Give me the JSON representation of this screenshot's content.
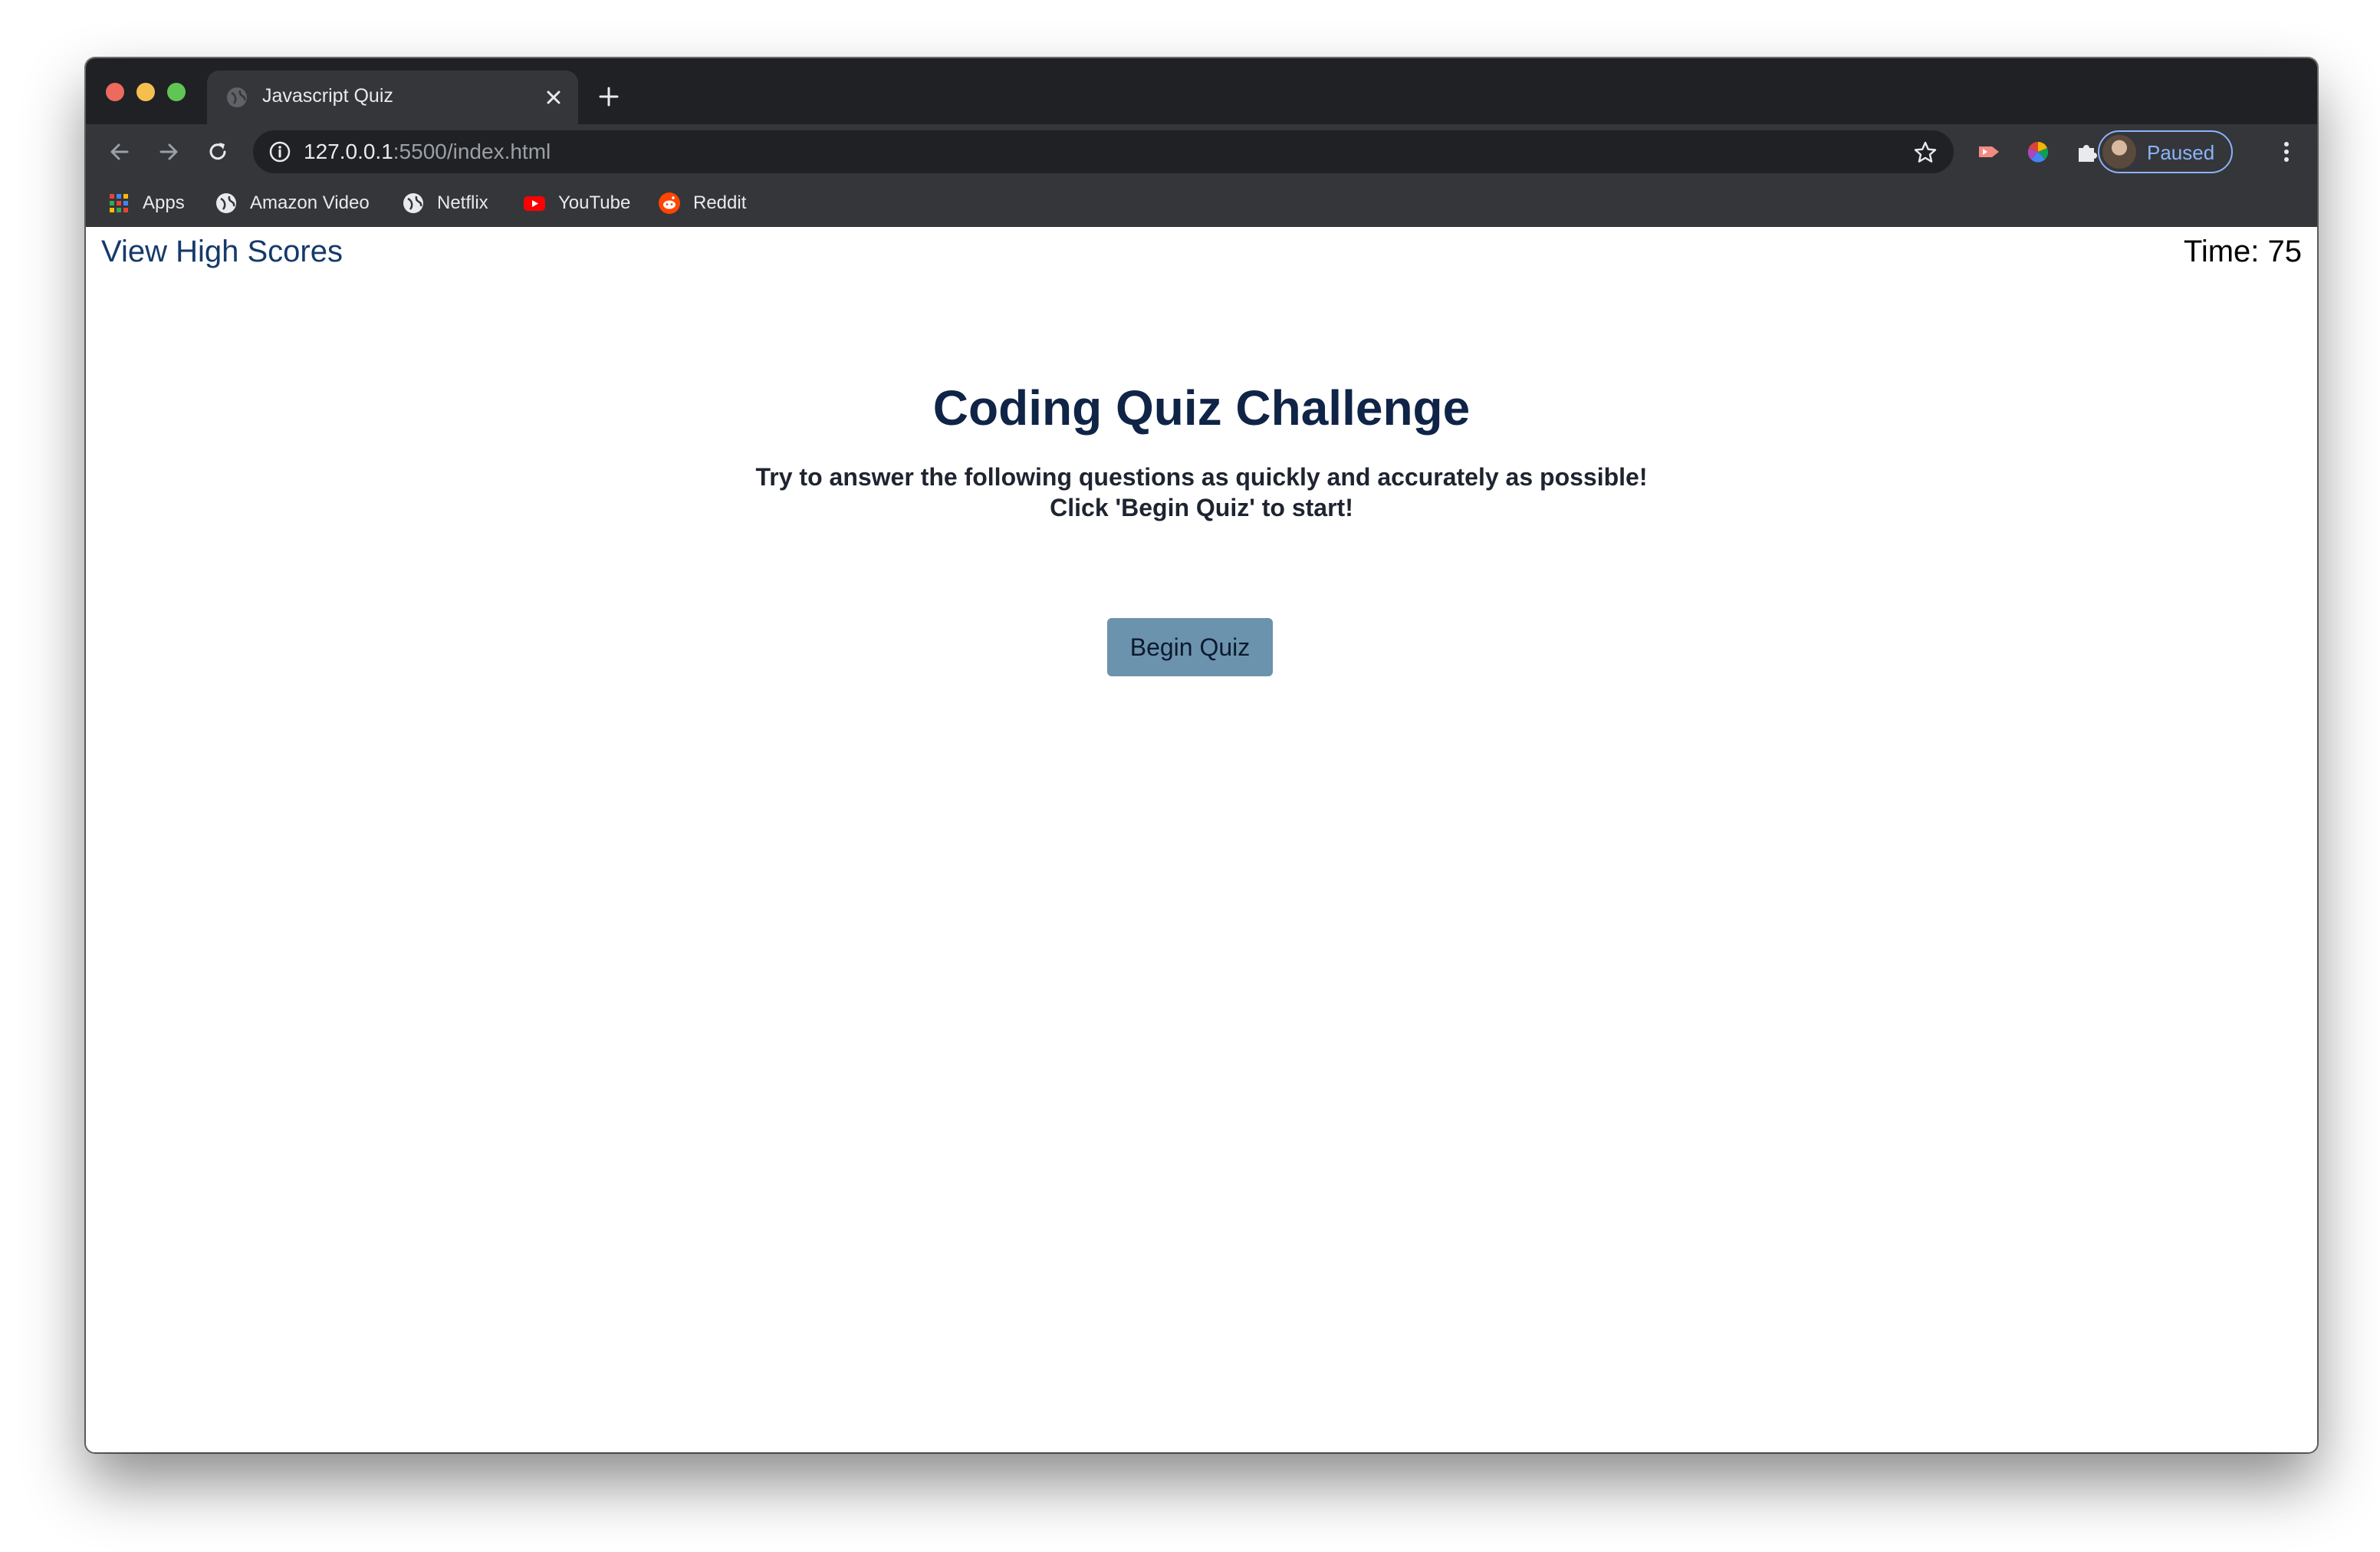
{
  "browser": {
    "tab_title": "Javascript Quiz",
    "url_host": "127.0.0.1",
    "url_path": ":5500/index.html",
    "profile_status": "Paused",
    "bookmarks": [
      {
        "label": "Apps",
        "icon": "apps-grid-icon"
      },
      {
        "label": "Amazon Video",
        "icon": "globe-icon"
      },
      {
        "label": "Netflix",
        "icon": "globe-icon"
      },
      {
        "label": "YouTube",
        "icon": "youtube-icon"
      },
      {
        "label": "Reddit",
        "icon": "reddit-icon"
      }
    ]
  },
  "header": {
    "high_scores_link": "View High Scores",
    "timer": "Time: 75"
  },
  "main": {
    "title": "Coding Quiz Challenge",
    "description": "Try to answer the following questions as quickly and accurately as possible! Click 'Begin Quiz' to start!",
    "begin_button": "Begin Quiz"
  },
  "colors": {
    "tab_bar": "#202124",
    "toolbar": "#35363a",
    "link": "#153a6b",
    "title": "#0f2447",
    "button_bg": "#6c93ad"
  }
}
